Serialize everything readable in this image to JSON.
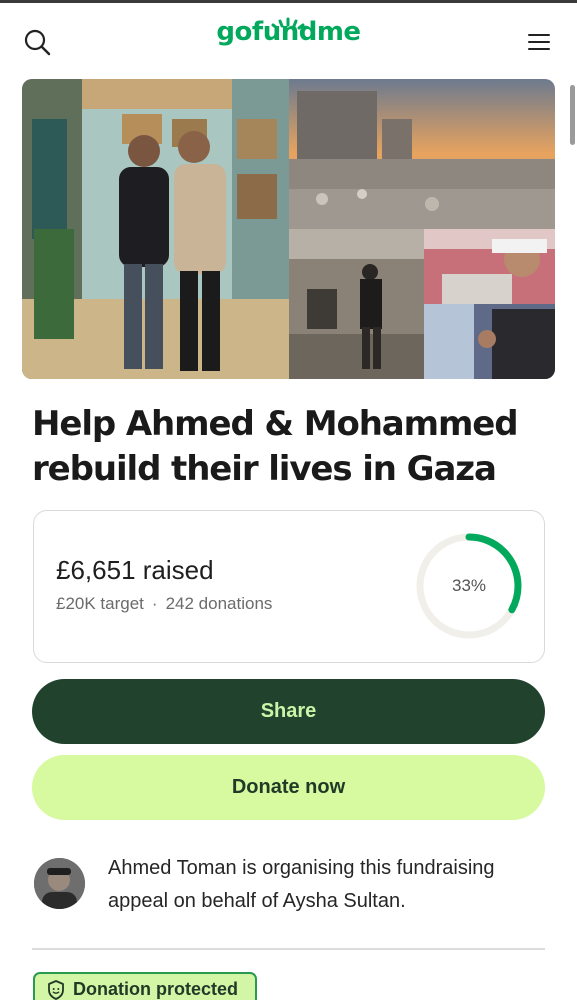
{
  "header": {
    "logo_text": "gofundme",
    "search_icon": "search-icon",
    "menu_icon": "hamburger-menu-icon"
  },
  "campaign": {
    "title": "Help Ahmed & Mohammed rebuild their lives in Gaza",
    "raised": "£6,651 raised",
    "target": "£20K target",
    "separator": "·",
    "donations": "242 donations",
    "progress_percent_label": "33%",
    "progress_fraction": 0.33
  },
  "actions": {
    "share_label": "Share",
    "donate_label": "Donate now"
  },
  "organiser": {
    "text": "Ahmed Toman is organising this fundraising appeal on behalf of Aysha Sultan."
  },
  "badge": {
    "label": "Donation protected",
    "icon": "shield-icon"
  },
  "colors": {
    "brand_green": "#02a95c",
    "share_bg": "#21432d",
    "donate_bg": "#d7f99f",
    "progress_ring": "#02a95c"
  }
}
